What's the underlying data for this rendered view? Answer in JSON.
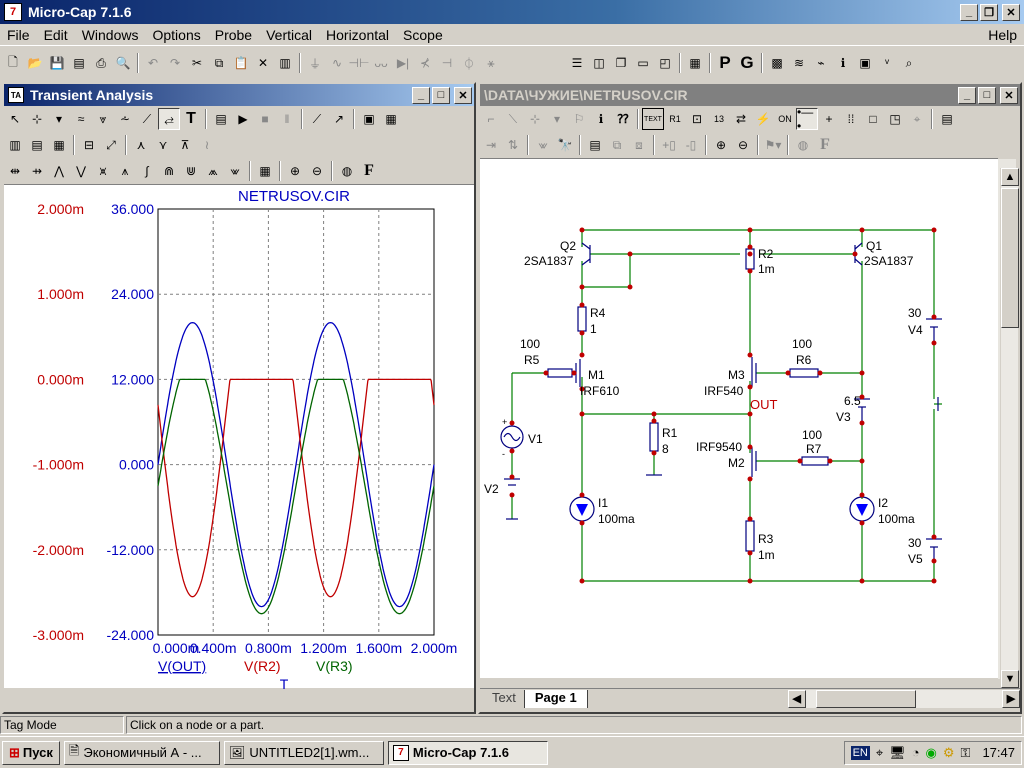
{
  "app": {
    "title": "Micro-Cap 7.1.6",
    "icon_text": "7"
  },
  "menu": [
    "File",
    "Edit",
    "Windows",
    "Options",
    "Probe",
    "Vertical",
    "Horizontal",
    "Scope",
    "Help"
  ],
  "main_toolbar_icons": [
    "new-icon",
    "open-icon",
    "save-icon",
    "save-all-icon",
    "print-icon",
    "print-preview-icon",
    "undo-icon",
    "redo-icon",
    "cut-icon",
    "copy-icon",
    "paste-icon",
    "delete-icon",
    "clear-icon",
    "ground-icon",
    "resistor-icon",
    "capacitor-icon",
    "inductor-icon",
    "diode-icon",
    "transistor-icon",
    "battery-icon",
    "source-icon",
    "wire-icon",
    "tile-horizontal-icon",
    "tile-vertical-icon",
    "cascade-icon",
    "window-icon",
    "window2-icon",
    "calculator-icon",
    "probe-icon",
    "grid-icon",
    "wave-icon",
    "info-icon",
    "check-icon",
    "library-icon",
    "find-icon"
  ],
  "main_toolbar_text_buttons": {
    "p": "P",
    "g": "G"
  },
  "transient": {
    "title": "Transient Analysis",
    "icon_text": "ТА"
  },
  "schematic": {
    "title": "\\DATA\\ЧУЖИЕ\\NETRUSOV.CIR",
    "tabs": [
      "Text",
      "Page 1"
    ],
    "active_tab": 1
  },
  "chart_data": {
    "type": "line",
    "title": "NETRUSOV.CIR",
    "x_ticks": [
      "0.000m",
      "0.400m",
      "0.800m",
      "1.200m",
      "1.600m",
      "2.000m"
    ],
    "x_unit_label": "T",
    "xlim": [
      0,
      2.0
    ],
    "left_axis": {
      "ticks": [
        "2.000m",
        "1.000m",
        "0.000m",
        "-1.000m",
        "-2.000m",
        "-3.000m"
      ],
      "ylim": [
        -3.0,
        2.0
      ],
      "color": "#c00000"
    },
    "right_axis": {
      "ticks": [
        "36.000",
        "24.000",
        "12.000",
        "0.000",
        "-12.000",
        "-24.000"
      ],
      "ylim": [
        -24,
        36
      ],
      "color": "#0000c0"
    },
    "grid": true,
    "series": [
      {
        "name": "V(OUT)",
        "color": "#0000c0",
        "axis": "right",
        "amplitude": 20,
        "offset": 0,
        "period_ms": 1.0,
        "phase": 0
      },
      {
        "name": "V(R2)",
        "color": "#c00000",
        "axis": "left",
        "amplitude": 2.25,
        "offset": -0.3,
        "clip_high": 0.0,
        "period_ms": 1.0,
        "phase": 180
      },
      {
        "name": "V(R3)",
        "color": "#006400",
        "axis": "right",
        "amplitude": 18,
        "offset": -3,
        "clip_high": 12,
        "period_ms": 1.0,
        "phase": 0
      }
    ]
  },
  "circuit": {
    "labels": {
      "q2": "Q2",
      "q2_part": "2SA1837",
      "q1": "Q1",
      "q1_part": "2SA1837",
      "r2": "R2",
      "r2_val": "1m",
      "r4": "R4",
      "r4_val": "1",
      "r5_val": "100",
      "r5": "R5",
      "m1": "M1",
      "m1_part": "IRF610",
      "m3": "M3",
      "m3_part": "IRF540",
      "r6_val": "100",
      "r6": "R6",
      "out": "OUT",
      "v4_val": "30",
      "v4": "V4",
      "v3_val": "6.5",
      "v3": "V3",
      "r1": "R1",
      "r1_val": "8",
      "v1": "V1",
      "v2": "V2",
      "m2_part": "IRF9540",
      "m2": "M2",
      "r7_val": "100",
      "r7": "R7",
      "i1": "I1",
      "i1_val": "100ma",
      "i2": "I2",
      "i2_val": "100ma",
      "r3": "R3",
      "r3_val": "1m",
      "v5_val": "30",
      "v5": "V5",
      "plus": "+",
      "minus": "-"
    }
  },
  "status": {
    "mode": "Tag Mode",
    "hint": "Click on a node or a part."
  },
  "taskbar": {
    "start": "Пуск",
    "tasks": [
      "Экономичный А - ...",
      "UNTITLED2[1].wm...",
      "Micro-Cap 7.1.6"
    ],
    "lang": "EN",
    "clock": "17:47"
  }
}
